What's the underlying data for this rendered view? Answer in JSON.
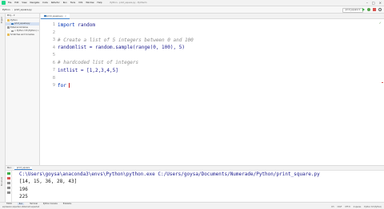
{
  "menubar": {
    "items": [
      "File",
      "Edit",
      "View",
      "Navigate",
      "Code",
      "Refactor",
      "Run",
      "Tools",
      "VCS",
      "Window",
      "Help"
    ],
    "window_title": "Python - print_square.py - PyCharm"
  },
  "navbar": {
    "project": "Python",
    "file": "print_square.py",
    "run_config": "print_square"
  },
  "project_panel": {
    "header": "Proj...",
    "items": [
      {
        "label": "Python",
        "icon": "folder-icon"
      },
      {
        "label": "print_square.py",
        "icon": "python-file-icon"
      },
      {
        "label": "External Libraries",
        "icon": "libraries-icon"
      },
      {
        "label": "< Python 3.8 (Python) >",
        "icon": "libraries-icon"
      },
      {
        "label": "Scratches and Consoles",
        "icon": "folder-icon"
      }
    ]
  },
  "editor": {
    "tab_label": "print_square.py",
    "line_numbers": [
      "1",
      "2",
      "3",
      "4",
      "5",
      "6",
      "7",
      "8",
      "9"
    ],
    "code": {
      "line1_kw": "import",
      "line1_rest": " random",
      "line3": "# Create a list of 5 integers between 0 and 100",
      "line4": "randomlist = random.sample(range(0, 100), 5)",
      "line6": "# hardcoded list of integers",
      "line7": "intlist = [1,2,3,4,5]",
      "line9": "for "
    }
  },
  "run_panel": {
    "title": "Run:",
    "tab": "print_square",
    "output": [
      "C:\\Users\\goysa\\anaconda3\\envs\\Python\\python.exe C:/Users/goysa/Documents/Numerade/Python/print_square.py",
      "[14, 15, 36, 28, 43]",
      "196",
      "225"
    ]
  },
  "bottom_tabs": [
    "TODO",
    "Run",
    "Terminal",
    "Python Console",
    "Problems"
  ],
  "statusbar": {
    "message": "expression expected, statement expected",
    "position": "9:5",
    "line_sep": "CRLF",
    "encoding": "UTF-8",
    "indent": "4 spaces",
    "interpreter": "Python 3.8 (Python)"
  },
  "colors": {
    "accent": "#4083c9",
    "keyword": "#0033b3",
    "comment": "#8c8c8c"
  }
}
